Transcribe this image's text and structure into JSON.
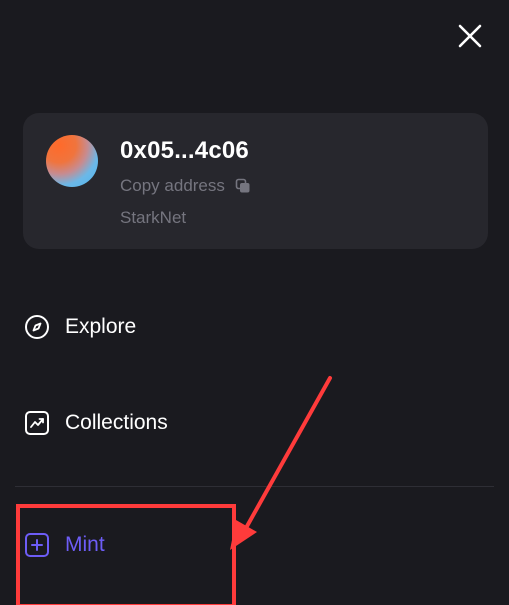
{
  "header": {
    "close_icon": "close-icon"
  },
  "account": {
    "address": "0x05...4c06",
    "copy_label": "Copy address",
    "copy_icon": "copy-icon",
    "network": "StarkNet",
    "avatar_colors": [
      "#ff6a2a",
      "#4fb6f0"
    ]
  },
  "nav": {
    "explore": {
      "label": "Explore",
      "icon": "compass-icon"
    },
    "collections": {
      "label": "Collections",
      "icon": "trending-chart-icon"
    },
    "mint": {
      "label": "Mint",
      "icon": "plus-square-icon"
    }
  },
  "colors": {
    "background": "#1a1a1f",
    "card": "#27272d",
    "accent": "#6d5df6",
    "annotation": "#ff3b3b",
    "muted_text": "#75757f"
  }
}
